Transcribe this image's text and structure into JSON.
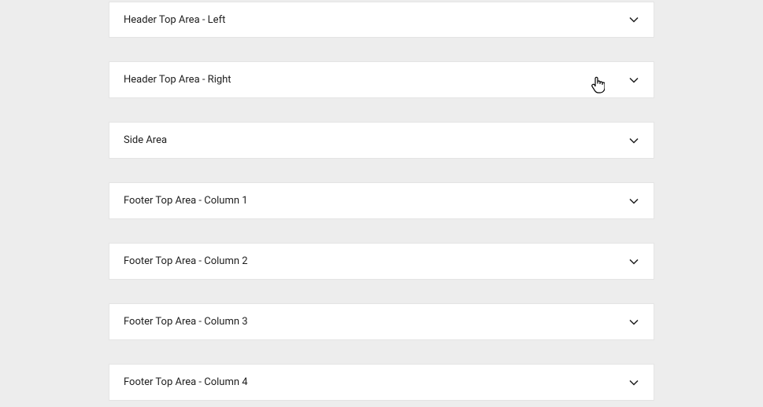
{
  "panels": [
    {
      "label": "Header Top Area - Left"
    },
    {
      "label": "Header Top Area - Right"
    },
    {
      "label": "Side Area"
    },
    {
      "label": "Footer Top Area - Column 1"
    },
    {
      "label": "Footer Top Area - Column 2"
    },
    {
      "label": "Footer Top Area - Column 3"
    },
    {
      "label": "Footer Top Area - Column 4"
    }
  ]
}
